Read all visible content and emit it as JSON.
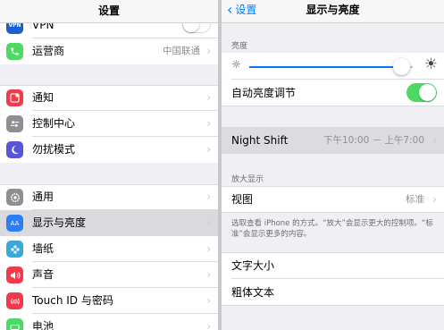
{
  "left": {
    "title": "设置",
    "rows": [
      {
        "label": "VPN",
        "icon": "vpn-icon",
        "color": "#1a5fd1"
      },
      {
        "label": "运营商",
        "value": "中国联通",
        "icon": "phone-icon",
        "color": "#4cd964"
      },
      {
        "label": "通知",
        "icon": "notifications-icon",
        "color": "#f4394a"
      },
      {
        "label": "控制中心",
        "icon": "control-center-icon",
        "color": "#8e8e93"
      },
      {
        "label": "勿扰模式",
        "icon": "moon-icon",
        "color": "#5856d6"
      },
      {
        "label": "通用",
        "icon": "gear-icon",
        "color": "#8e8e93"
      },
      {
        "label": "显示与亮度",
        "icon": "display-icon",
        "color": "#2c7ef2"
      },
      {
        "label": "墙纸",
        "icon": "wallpaper-icon",
        "color": "#35aadc"
      },
      {
        "label": "声音",
        "icon": "speaker-icon",
        "color": "#f4394a"
      },
      {
        "label": "Touch ID 与密码",
        "icon": "fingerprint-icon",
        "color": "#f4394a"
      },
      {
        "label": "电池",
        "icon": "battery-icon",
        "color": "#4cd964"
      }
    ],
    "vpn_toggle": "off"
  },
  "right": {
    "back_label": "设置",
    "title": "显示与亮度",
    "brightness_header": "亮度",
    "brightness_level": 0.93,
    "auto_brightness_label": "自动亮度调节",
    "auto_brightness_state": "on",
    "night_shift_label": "Night Shift",
    "night_shift_value": "下午10:00 － 上午7:00",
    "zoom_header": "放大显示",
    "view_label": "视图",
    "view_value": "标准",
    "footnote": "选取查看 iPhone 的方式。“放大”会显示更大的控制项。“标准”会显示更多的内容。",
    "text_size_label": "文字大小",
    "bold_text_label": "粗体文本"
  },
  "colors": {
    "accent": "#007aff",
    "toggle_on": "#4cd964",
    "selected_row": "#d9d9de",
    "group_bg": "#efeff4"
  }
}
